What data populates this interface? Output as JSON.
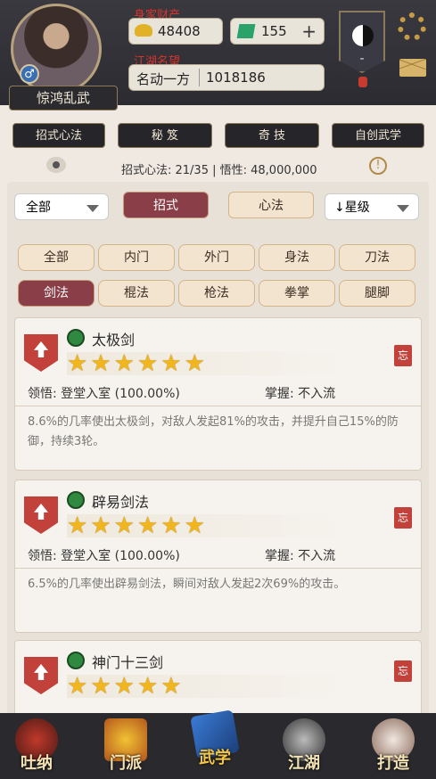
{
  "header": {
    "player_name": "惊鸿乱武",
    "gender_symbol": "♂",
    "wealth_label": "身家财产",
    "gold": "48408",
    "jade": "155",
    "add_symbol": "+",
    "fame_label": "江湖名望",
    "fame_title": "名动一方",
    "fame_value": "1018186",
    "top_right_dash": "-"
  },
  "tabs": [
    {
      "label": "招式心法",
      "active": true
    },
    {
      "label": "秘 笈"
    },
    {
      "label": "奇 技"
    },
    {
      "label": "自创武学"
    }
  ],
  "stats": {
    "text": "招式心法: 21/35 | 悟性: 48,000,000"
  },
  "filters": {
    "category_select": "全部",
    "tab_moves": "招式",
    "tab_heart": "心法",
    "sort_select": "↓星级"
  },
  "chips_row1": [
    "全部",
    "内门",
    "外门",
    "身法",
    "刀法"
  ],
  "chips_row2": [
    "剑法",
    "棍法",
    "枪法",
    "拳掌",
    "腿脚"
  ],
  "skills": [
    {
      "name": "太极剑",
      "stars": 6,
      "comprehension": "领悟: 登堂入室 (100.00%)",
      "mastery": "掌握:  不入流",
      "desc": "8.6%的几率使出太极剑，对敌人发起81%的攻击，并提升自己15%的防御，持续3轮。",
      "seal": "忘"
    },
    {
      "name": "辟易剑法",
      "stars": 6,
      "comprehension": "领悟: 登堂入室 (100.00%)",
      "mastery": "掌握:  不入流",
      "desc": "6.5%的几率使出辟易剑法，瞬间对敌人发起2次69%的攻击。",
      "seal": "忘"
    },
    {
      "name": "神门十三剑",
      "stars": 5,
      "seal": "忘"
    }
  ],
  "bottom_nav": [
    "吐纳",
    "门派",
    "武学",
    "江湖",
    "打造"
  ],
  "colors": {
    "accent": "#8a3e47",
    "star": "#f1b51d",
    "header_bg": "#2b2b31"
  }
}
